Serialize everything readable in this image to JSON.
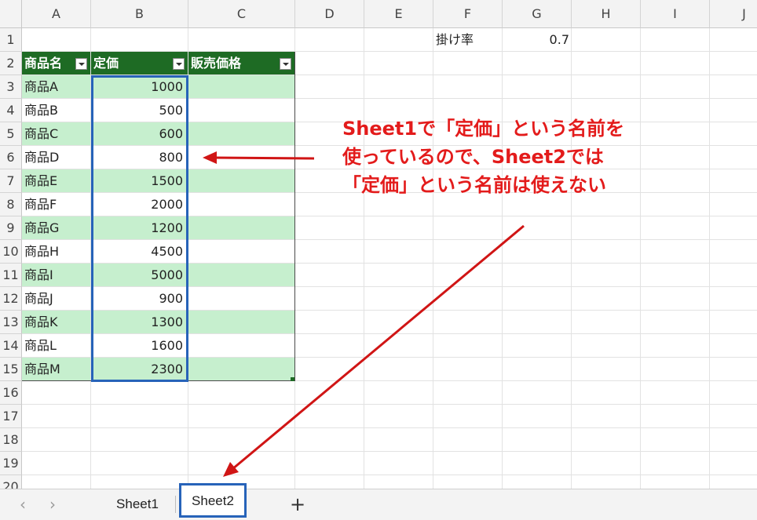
{
  "columns": [
    "A",
    "B",
    "C",
    "D",
    "E",
    "F",
    "G",
    "H",
    "I",
    "J"
  ],
  "rows": [
    "1",
    "2",
    "3",
    "4",
    "5",
    "6",
    "7",
    "8",
    "9",
    "10",
    "11",
    "12",
    "13",
    "14",
    "15",
    "16",
    "17",
    "18",
    "19",
    "20"
  ],
  "rate_label": "掛け率",
  "rate_value": "0.7",
  "table": {
    "headers": [
      "商品名",
      "定価",
      "販売価格"
    ],
    "rows": [
      {
        "name": "商品A",
        "price": "1000"
      },
      {
        "name": "商品B",
        "price": "500"
      },
      {
        "name": "商品C",
        "price": "600"
      },
      {
        "name": "商品D",
        "price": "800"
      },
      {
        "name": "商品E",
        "price": "1500"
      },
      {
        "name": "商品F",
        "price": "2000"
      },
      {
        "name": "商品G",
        "price": "1200"
      },
      {
        "name": "商品H",
        "price": "4500"
      },
      {
        "name": "商品I",
        "price": "5000"
      },
      {
        "name": "商品J",
        "price": "900"
      },
      {
        "name": "商品K",
        "price": "1300"
      },
      {
        "name": "商品L",
        "price": "1600"
      },
      {
        "name": "商品M",
        "price": "2300"
      }
    ]
  },
  "callout": {
    "lines": [
      "Sheet1で「定価」という名前を",
      "使っているので、Sheet2では",
      "「定価」という名前は使えない"
    ]
  },
  "tabs": {
    "prev": "‹",
    "next": "›",
    "sheet1": "Sheet1",
    "sheet2": "Sheet2",
    "add": "+"
  },
  "colors": {
    "header_green": "#1e6b24",
    "band_green": "#c6efce",
    "highlight_blue": "#2763b9",
    "annotation_red": "#e31b1b"
  }
}
